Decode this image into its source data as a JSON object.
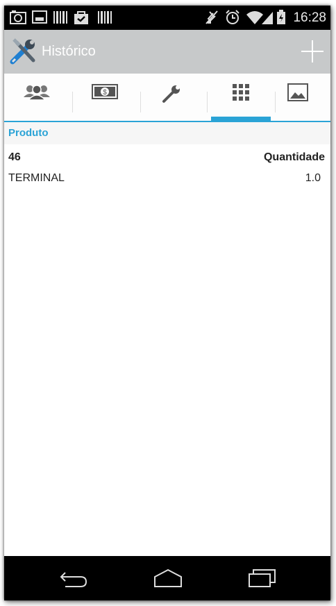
{
  "status_bar": {
    "time": "16:28",
    "left_icons": [
      "camera-icon",
      "image-icon",
      "barcode-icon",
      "shopping-bag-icon",
      "barcode-icon"
    ],
    "right_icons": [
      "mute-icon",
      "alarm-icon",
      "wifi-icon",
      "signal-icon",
      "battery-icon"
    ]
  },
  "action_bar": {
    "title": "Histórico",
    "app_icon": "tools-icon",
    "action_icon": "plus-icon"
  },
  "tabs": [
    {
      "icon": "people-icon",
      "selected": false
    },
    {
      "icon": "money-icon",
      "selected": false
    },
    {
      "icon": "wrench-icon",
      "selected": false
    },
    {
      "icon": "grid-icon",
      "selected": true
    },
    {
      "icon": "picture-icon",
      "selected": false
    }
  ],
  "section": {
    "header": "Produto"
  },
  "product": {
    "code": "46",
    "quantity_label": "Quantidade",
    "name": "TERMINAL",
    "quantity": "1.0"
  },
  "nav_bar": {
    "icons": [
      "back-icon",
      "home-icon",
      "recent-apps-icon"
    ]
  },
  "colors": {
    "accent": "#2aa3d6",
    "action_bar": "#c7c9ca",
    "status_bar": "#000000"
  }
}
